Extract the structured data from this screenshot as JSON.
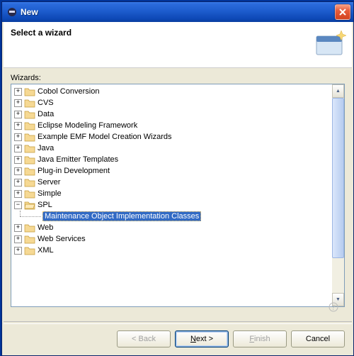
{
  "titlebar": {
    "title": "New"
  },
  "banner": {
    "title": "Select a wizard"
  },
  "tree": {
    "label": "Wizards:",
    "folders": [
      {
        "label": "Cobol Conversion",
        "expanded": false
      },
      {
        "label": "CVS",
        "expanded": false
      },
      {
        "label": "Data",
        "expanded": false
      },
      {
        "label": "Eclipse Modeling Framework",
        "expanded": false
      },
      {
        "label": "Example EMF Model Creation Wizards",
        "expanded": false
      },
      {
        "label": "Java",
        "expanded": false
      },
      {
        "label": "Java Emitter Templates",
        "expanded": false
      },
      {
        "label": "Plug-in Development",
        "expanded": false
      },
      {
        "label": "Server",
        "expanded": false
      },
      {
        "label": "Simple",
        "expanded": false
      },
      {
        "label": "SPL",
        "expanded": true,
        "children": [
          {
            "label": "Maintenance Object Implementation Classes",
            "selected": true
          }
        ]
      },
      {
        "label": "Web",
        "expanded": false
      },
      {
        "label": "Web Services",
        "expanded": false
      },
      {
        "label": "XML",
        "expanded": false
      }
    ]
  },
  "buttons": {
    "back": "< Back",
    "next_pre": "N",
    "next_post": "ext >",
    "finish_pre": "F",
    "finish_post": "inish",
    "cancel": "Cancel"
  }
}
